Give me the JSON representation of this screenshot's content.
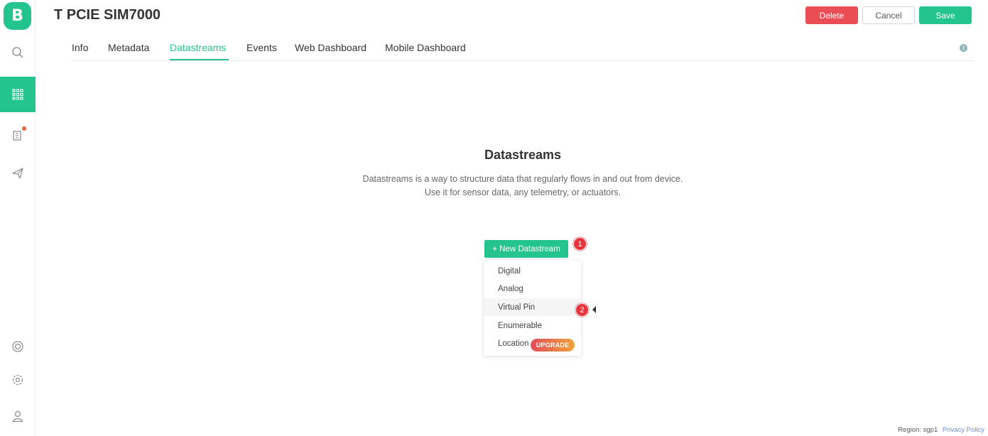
{
  "sidebar": {
    "logo": "B",
    "items": [
      {
        "icon": "search-icon"
      },
      {
        "icon": "grid-icon",
        "active": true
      },
      {
        "icon": "building-icon",
        "notification": true
      },
      {
        "icon": "send-icon"
      },
      {
        "icon": "lifebuoy-icon"
      },
      {
        "icon": "gear-icon"
      },
      {
        "icon": "user-icon"
      }
    ]
  },
  "header": {
    "title": "T PCIE SIM7000",
    "delete_label": "Delete",
    "cancel_label": "Cancel",
    "save_label": "Save"
  },
  "tabs": [
    {
      "label": "Info"
    },
    {
      "label": "Metadata"
    },
    {
      "label": "Datastreams",
      "active": true
    },
    {
      "label": "Events"
    },
    {
      "label": "Web Dashboard"
    },
    {
      "label": "Mobile Dashboard"
    }
  ],
  "empty_state": {
    "title": "Datastreams",
    "line1": "Datastreams is a way to structure data that regularly flows in and out from device.",
    "line2": "Use it for sensor data, any telemetry, or actuators."
  },
  "new_datastream_label": "+ New Datastream",
  "step_badges": [
    "1",
    "2"
  ],
  "menu": {
    "items": [
      {
        "label": "Digital"
      },
      {
        "label": "Analog"
      },
      {
        "label": "Virtual Pin",
        "hover": true
      },
      {
        "label": "Enumerable"
      },
      {
        "label": "Location",
        "badge": "UPGRADE"
      }
    ]
  },
  "footer": {
    "region": "Region: sgp1",
    "privacy": "Privacy Policy"
  },
  "colors": {
    "accent": "#23c48e",
    "danger": "#eb4d55",
    "badge": "#e8343c"
  }
}
